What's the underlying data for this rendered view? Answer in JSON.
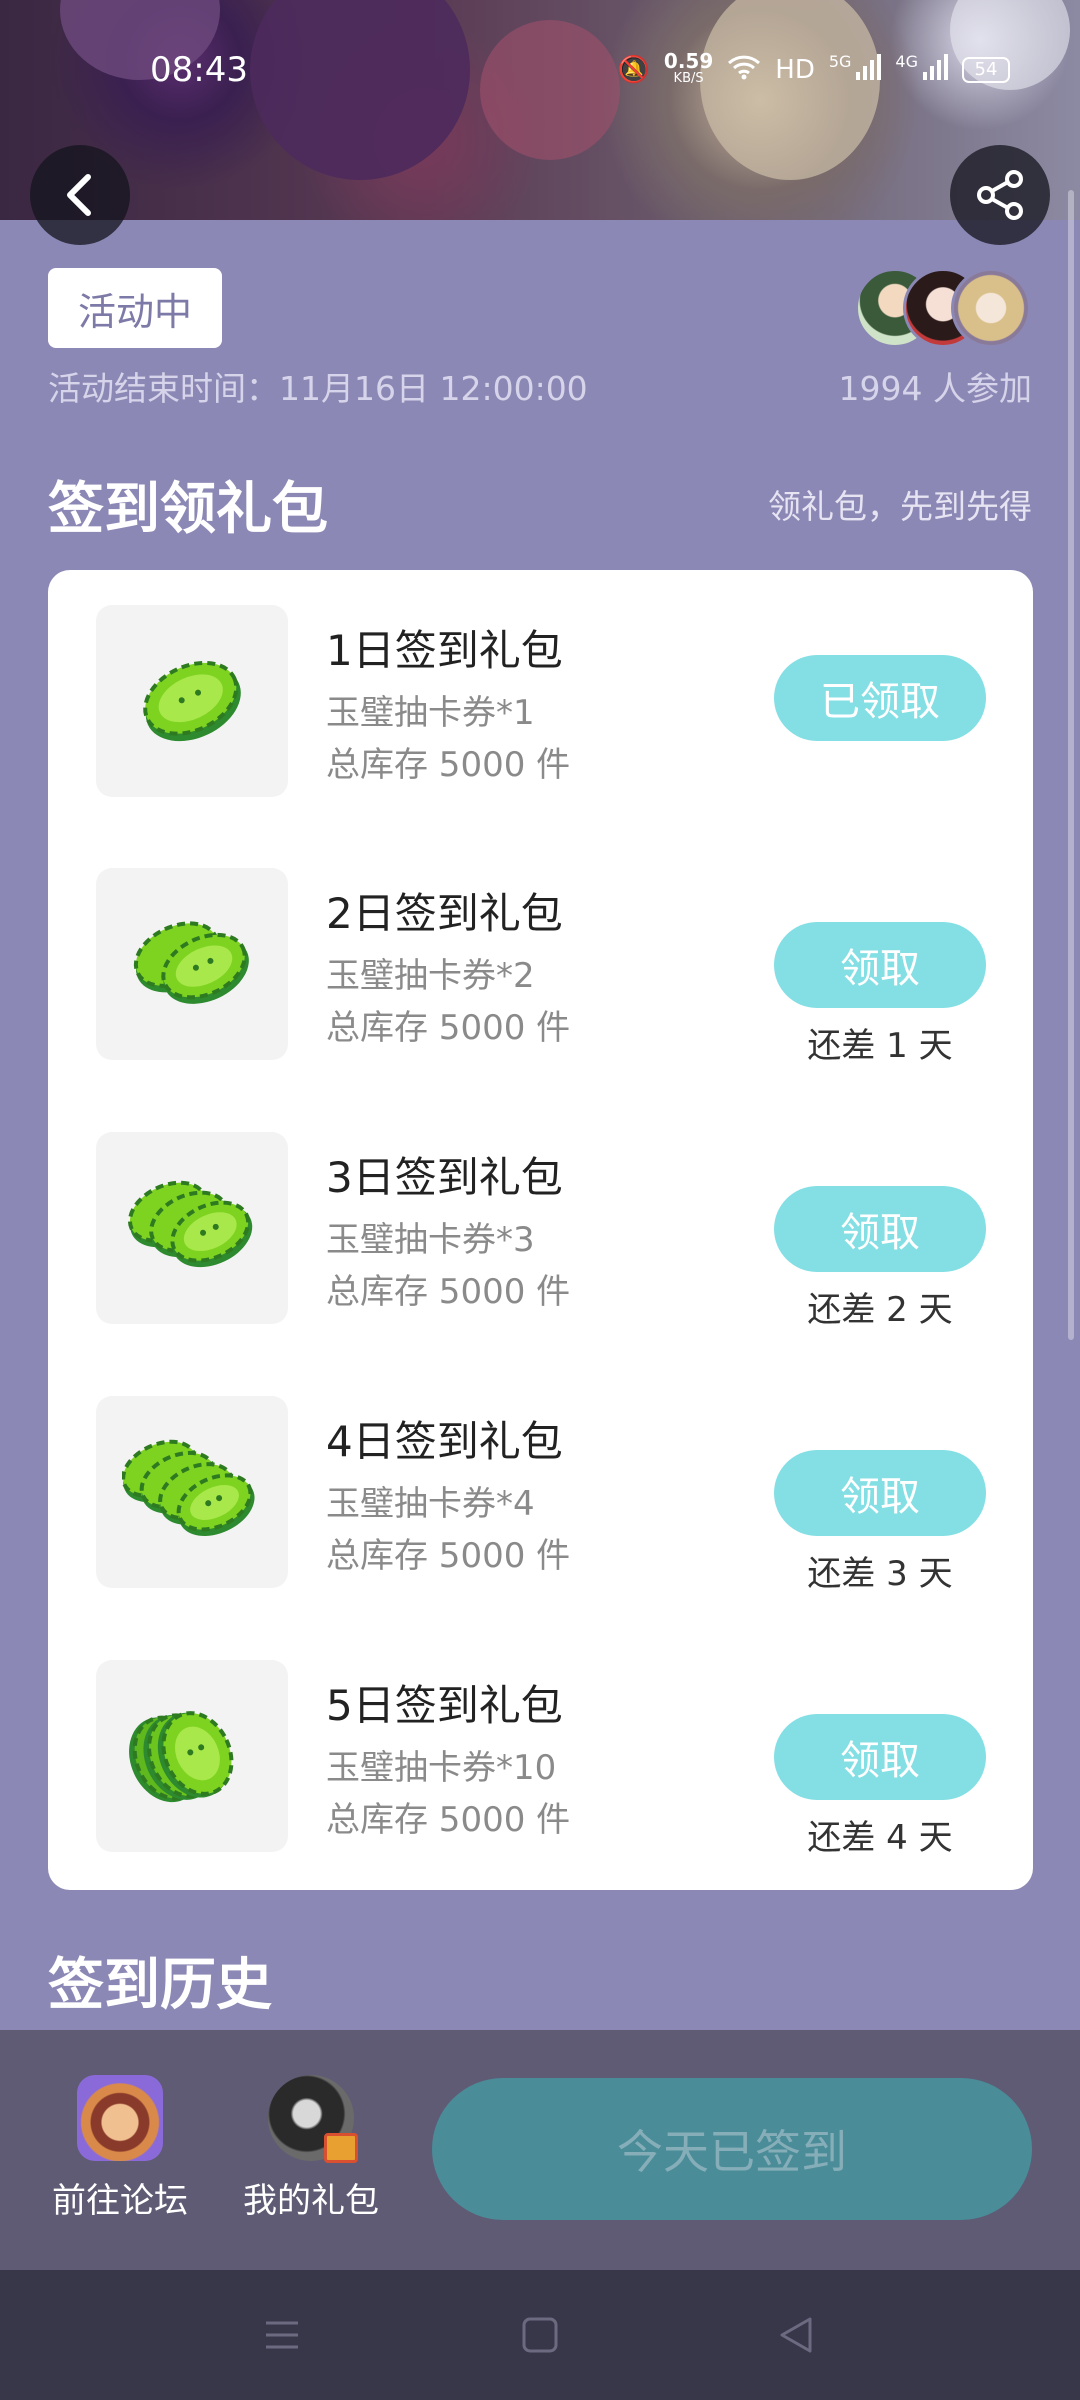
{
  "status_bar": {
    "time": "08:43",
    "net_speed": "0.59",
    "net_unit": "KB/S",
    "hd": "HD",
    "signal_5g": "5G",
    "signal_4g": "4G",
    "battery": "54"
  },
  "activity": {
    "status_badge": "活动中",
    "end_time": "活动结束时间：11月16日 12:00:00",
    "participants": "1994 人参加"
  },
  "signin_section": {
    "title": "签到领礼包",
    "hint": "领礼包，先到先得",
    "items": [
      {
        "title": "1日签到礼包",
        "reward": "玉璧抽卡券*1",
        "stock": "总库存 5000 件",
        "button": "已领取",
        "remain": ""
      },
      {
        "title": "2日签到礼包",
        "reward": "玉璧抽卡券*2",
        "stock": "总库存 5000 件",
        "button": "领取",
        "remain": "还差 1 天"
      },
      {
        "title": "3日签到礼包",
        "reward": "玉璧抽卡券*3",
        "stock": "总库存 5000 件",
        "button": "领取",
        "remain": "还差 2 天"
      },
      {
        "title": "4日签到礼包",
        "reward": "玉璧抽卡券*4",
        "stock": "总库存 5000 件",
        "button": "领取",
        "remain": "还差 3 天"
      },
      {
        "title": "5日签到礼包",
        "reward": "玉璧抽卡券*10",
        "stock": "总库存 5000 件",
        "button": "领取",
        "remain": "还差 4 天"
      }
    ]
  },
  "history_section": {
    "title": "签到历史"
  },
  "bottom_bar": {
    "forum_label": "前往论坛",
    "gifts_label": "我的礼包",
    "signed_button": "今天已签到"
  },
  "icons": {
    "back": "chevron-left-icon",
    "share": "share-icon",
    "coupon": "jade-coupon-icon"
  },
  "colors": {
    "page_bg": "#8c88b5",
    "claim_button": "#84dfe4",
    "signed_button": "#4a8c98",
    "bottom_bar": "#5f5b74",
    "system_nav": "#383749"
  }
}
